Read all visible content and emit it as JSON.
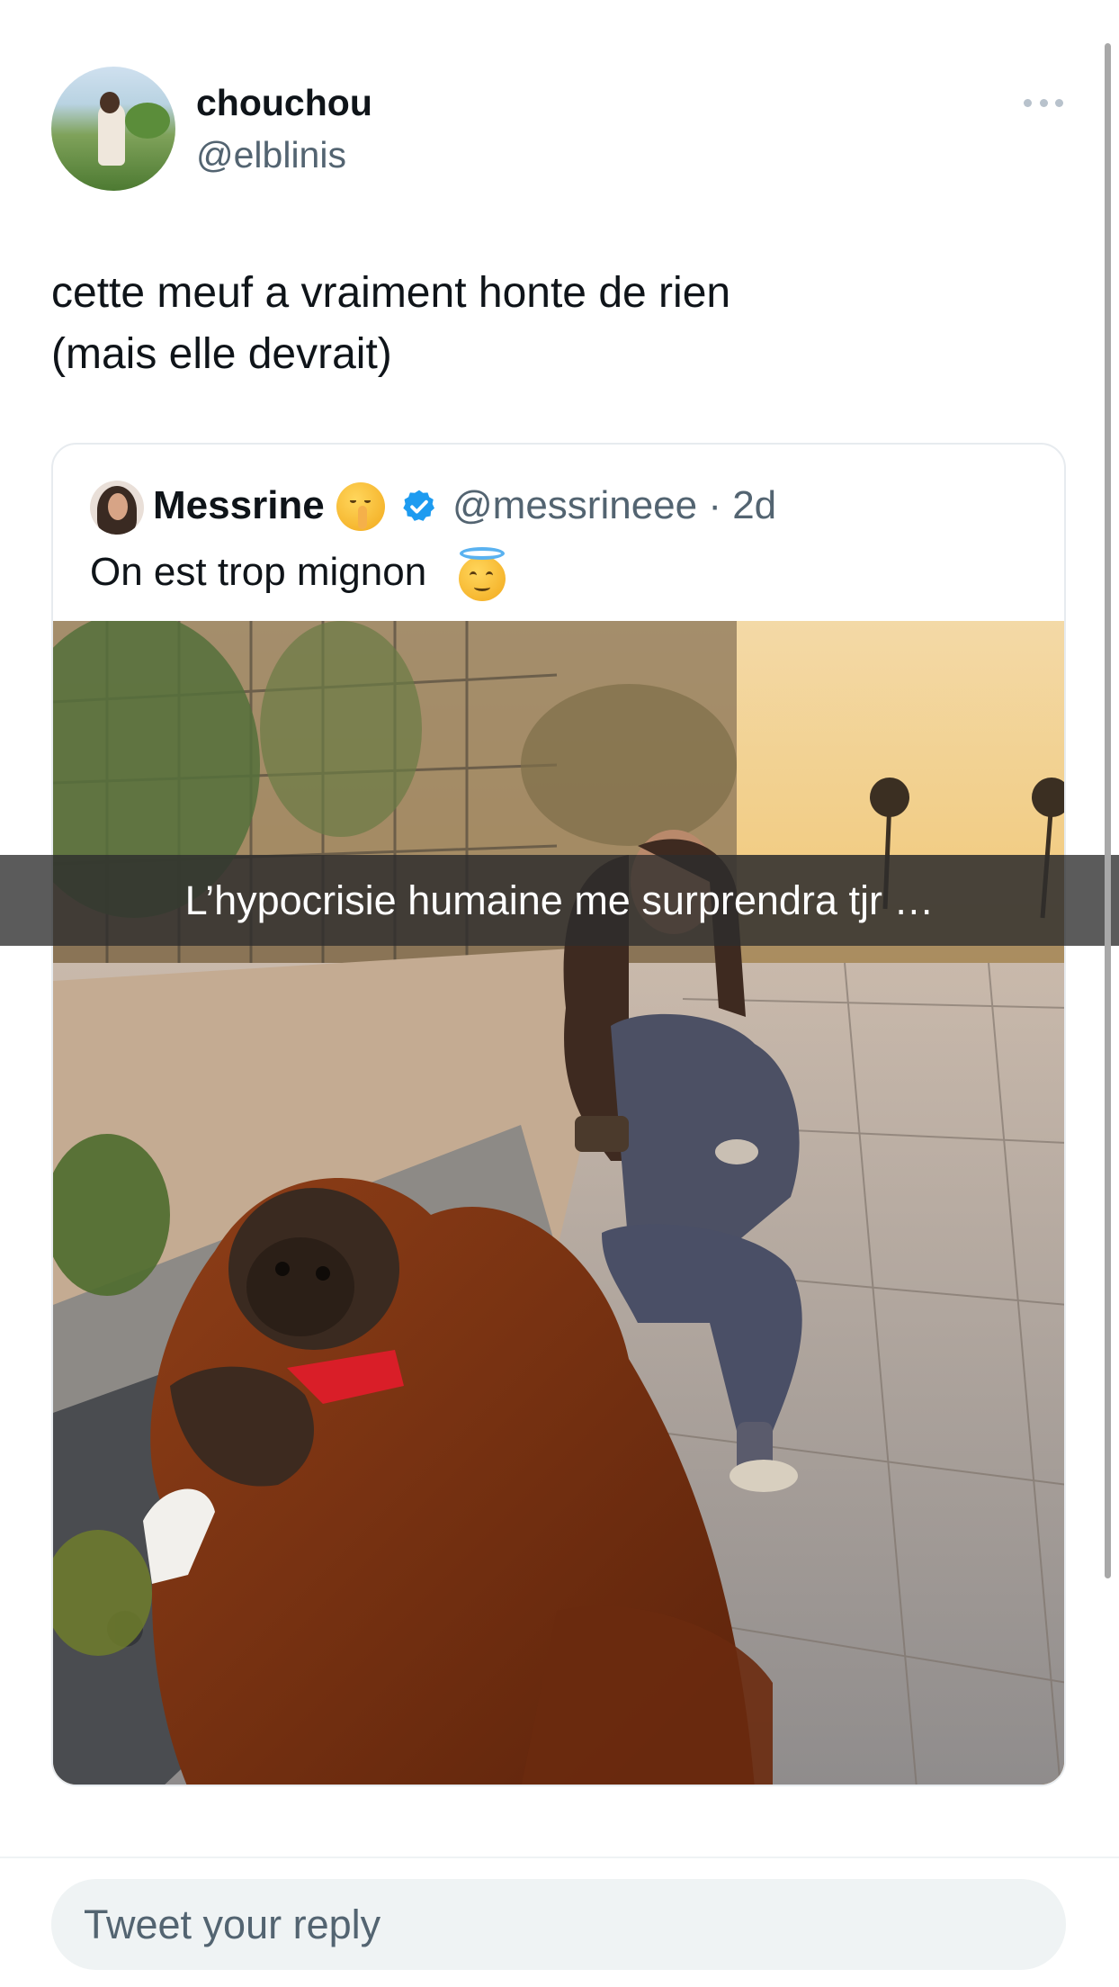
{
  "tweet": {
    "author": {
      "display_name": "chouchou",
      "handle": "@elblinis"
    },
    "text": "cette meuf a vraiment honte de rien\n(mais elle devrait)",
    "more_icon": "more-horizontal-icon"
  },
  "quoted_tweet": {
    "author": {
      "display_name": "Messrine",
      "handle_time": "@messrineee · 2d",
      "verified": true
    },
    "name_emoji": "shushing-face-emoji",
    "text": "On est trop mignon",
    "text_emoji": "smiling-face-with-halo-emoji",
    "image": {
      "overlay_caption": "L’hypocrisie humaine me surprendra tjr …"
    }
  },
  "reply": {
    "placeholder": "Tweet your reply"
  },
  "colors": {
    "text": "#0f1419",
    "secondary_text": "#536471",
    "verified": "#1d9bf0",
    "border": "#e7ebef",
    "input_bg": "#eff3f4"
  }
}
